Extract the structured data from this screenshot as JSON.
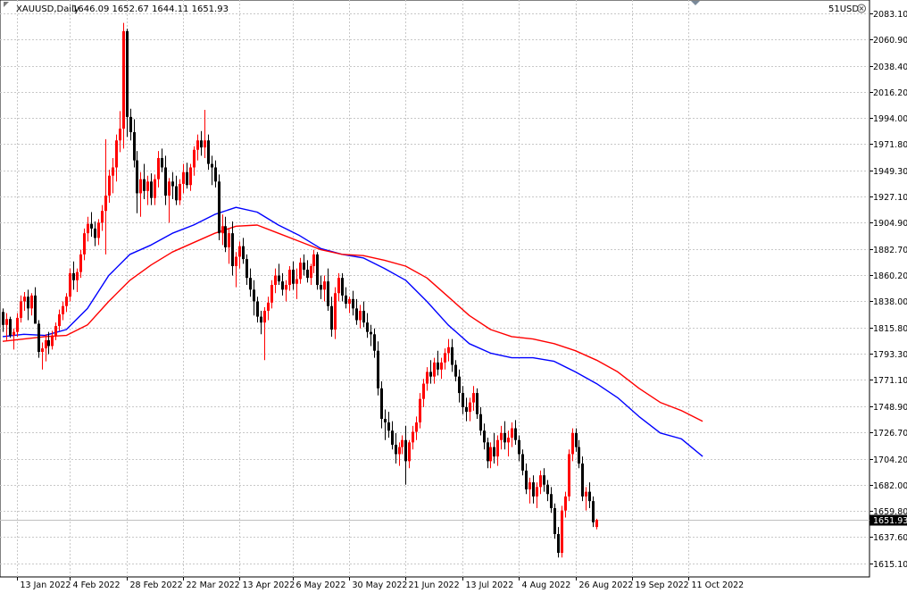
{
  "header": {
    "symbol_timeframe": "XAUUSD,Daily",
    "ohlc": "1646.09 1652.67 1644.11 1651.93",
    "account_label": "51USD"
  },
  "icons": {
    "close": "close-circle-icon",
    "scroll_marker": "triangle-down-icon"
  },
  "colors": {
    "background": "#ffffff",
    "grid": "#c8c8c8",
    "axis": "#000000",
    "bull_candle": "#ff0000",
    "bear_candle": "#000000",
    "ma_fast": "#0000ff",
    "ma_slow": "#ff0000",
    "last_price_tag_bg": "#000000",
    "last_price_tag_fg": "#ffffff",
    "last_price_line": "#c0c0c0"
  },
  "chart_data": {
    "type": "candlestick",
    "title": "",
    "symbol": "XAUUSD",
    "timeframe": "Daily",
    "ylim": [
      1603.5,
      2094.5
    ],
    "grid": true,
    "last_price": 1651.93,
    "last_price_label": "1651.93",
    "y_ticks": [
      {
        "value": 2083.1,
        "label": "2083.10"
      },
      {
        "value": 2060.9,
        "label": "2060.90"
      },
      {
        "value": 2038.4,
        "label": "2038.40"
      },
      {
        "value": 2016.2,
        "label": "2016.20"
      },
      {
        "value": 1994.0,
        "label": "1994.00"
      },
      {
        "value": 1971.8,
        "label": "1971.80"
      },
      {
        "value": 1949.3,
        "label": "1949.30"
      },
      {
        "value": 1927.1,
        "label": "1927.10"
      },
      {
        "value": 1904.9,
        "label": "1904.90"
      },
      {
        "value": 1882.7,
        "label": "1882.70"
      },
      {
        "value": 1860.2,
        "label": "1860.20"
      },
      {
        "value": 1838.0,
        "label": "1838.00"
      },
      {
        "value": 1815.8,
        "label": "1815.80"
      },
      {
        "value": 1793.3,
        "label": "1793.30"
      },
      {
        "value": 1771.1,
        "label": "1771.10"
      },
      {
        "value": 1748.9,
        "label": "1748.90"
      },
      {
        "value": 1726.7,
        "label": "1726.70"
      },
      {
        "value": 1704.2,
        "label": "1704.20"
      },
      {
        "value": 1682.0,
        "label": "1682.00"
      },
      {
        "value": 1659.8,
        "label": "1659.80"
      },
      {
        "value": 1637.6,
        "label": "1637.60"
      },
      {
        "value": 1615.1,
        "label": "1615.10"
      }
    ],
    "x_ticks": [
      {
        "index": 4,
        "label": "13 Jan 2022"
      },
      {
        "index": 19,
        "label": "4 Feb 2022"
      },
      {
        "index": 35,
        "label": "28 Feb 2022"
      },
      {
        "index": 51,
        "label": "22 Mar 2022"
      },
      {
        "index": 67,
        "label": "13 Apr 2022"
      },
      {
        "index": 82,
        "label": "6 May 2022"
      },
      {
        "index": 98,
        "label": "30 May 2022"
      },
      {
        "index": 114,
        "label": "21 Jun 2022"
      },
      {
        "index": 130,
        "label": "13 Jul 2022"
      },
      {
        "index": 146,
        "label": "4 Aug 2022"
      },
      {
        "index": 162,
        "label": "26 Aug 2022"
      },
      {
        "index": 178,
        "label": "19 Sep 2022"
      },
      {
        "index": 194,
        "label": "11 Oct 2022"
      }
    ],
    "candles": [
      [
        1829,
        1832,
        1812,
        1818
      ],
      [
        1818,
        1828,
        1805,
        1823
      ],
      [
        1823,
        1825,
        1807,
        1809
      ],
      [
        1809,
        1815,
        1797,
        1812
      ],
      [
        1812,
        1828,
        1808,
        1824
      ],
      [
        1824,
        1843,
        1820,
        1838
      ],
      [
        1838,
        1846,
        1830,
        1842
      ],
      [
        1842,
        1848,
        1822,
        1832
      ],
      [
        1832,
        1845,
        1826,
        1843
      ],
      [
        1843,
        1850,
        1832,
        1819
      ],
      [
        1819,
        1822,
        1790,
        1795
      ],
      [
        1795,
        1803,
        1780,
        1798
      ],
      [
        1798,
        1810,
        1787,
        1805
      ],
      [
        1805,
        1812,
        1793,
        1800
      ],
      [
        1800,
        1813,
        1797,
        1809
      ],
      [
        1809,
        1820,
        1805,
        1817
      ],
      [
        1817,
        1831,
        1813,
        1827
      ],
      [
        1827,
        1838,
        1822,
        1834
      ],
      [
        1834,
        1845,
        1829,
        1842
      ],
      [
        1842,
        1866,
        1838,
        1862
      ],
      [
        1862,
        1872,
        1848,
        1856
      ],
      [
        1856,
        1866,
        1846,
        1863
      ],
      [
        1863,
        1882,
        1858,
        1878
      ],
      [
        1878,
        1900,
        1873,
        1896
      ],
      [
        1896,
        1910,
        1889,
        1904
      ],
      [
        1904,
        1914,
        1893,
        1900
      ],
      [
        1900,
        1906,
        1885,
        1892
      ],
      [
        1892,
        1908,
        1886,
        1905
      ],
      [
        1905,
        1920,
        1898,
        1915
      ],
      [
        1915,
        1976,
        1878,
        1928
      ],
      [
        1928,
        1950,
        1922,
        1945
      ],
      [
        1945,
        1960,
        1930,
        1952
      ],
      [
        1952,
        1980,
        1940,
        1975
      ],
      [
        1975,
        2000,
        1965,
        1985
      ],
      [
        1985,
        2075,
        1968,
        2068
      ],
      [
        2068,
        2070,
        1978,
        1995
      ],
      [
        1995,
        2002,
        1975,
        1982
      ],
      [
        1982,
        1993,
        1952,
        1958
      ],
      [
        1958,
        1966,
        1913,
        1930
      ],
      [
        1930,
        1948,
        1910,
        1942
      ],
      [
        1942,
        1955,
        1925,
        1932
      ],
      [
        1932,
        1945,
        1920,
        1940
      ],
      [
        1940,
        1947,
        1920,
        1926
      ],
      [
        1926,
        1946,
        1920,
        1942
      ],
      [
        1942,
        1966,
        1935,
        1960
      ],
      [
        1960,
        1968,
        1948,
        1952
      ],
      [
        1952,
        1962,
        1920,
        1928
      ],
      [
        1928,
        1943,
        1905,
        1940
      ],
      [
        1940,
        1948,
        1925,
        1936
      ],
      [
        1936,
        1945,
        1920,
        1924
      ],
      [
        1924,
        1942,
        1920,
        1938
      ],
      [
        1938,
        1955,
        1930,
        1948
      ],
      [
        1948,
        1956,
        1934,
        1937
      ],
      [
        1937,
        1955,
        1932,
        1952
      ],
      [
        1952,
        1970,
        1945,
        1967
      ],
      [
        1967,
        1980,
        1958,
        1975
      ],
      [
        1975,
        1983,
        1962,
        1969
      ],
      [
        1969,
        2001,
        1960,
        1975
      ],
      [
        1975,
        1980,
        1950,
        1955
      ],
      [
        1955,
        1962,
        1937,
        1952
      ],
      [
        1952,
        1958,
        1935,
        1940
      ],
      [
        1940,
        1946,
        1890,
        1896
      ],
      [
        1896,
        1912,
        1886,
        1902
      ],
      [
        1902,
        1910,
        1880,
        1884
      ],
      [
        1884,
        1900,
        1870,
        1896
      ],
      [
        1896,
        1906,
        1860,
        1868
      ],
      [
        1868,
        1880,
        1850,
        1876
      ],
      [
        1876,
        1889,
        1866,
        1885
      ],
      [
        1885,
        1892,
        1870,
        1874
      ],
      [
        1874,
        1878,
        1852,
        1858
      ],
      [
        1858,
        1866,
        1842,
        1848
      ],
      [
        1848,
        1856,
        1826,
        1838
      ],
      [
        1838,
        1842,
        1820,
        1825
      ],
      [
        1825,
        1830,
        1810,
        1820
      ],
      [
        1820,
        1833,
        1788,
        1830
      ],
      [
        1830,
        1842,
        1822,
        1837
      ],
      [
        1837,
        1856,
        1832,
        1852
      ],
      [
        1852,
        1866,
        1845,
        1860
      ],
      [
        1860,
        1870,
        1852,
        1855
      ],
      [
        1855,
        1862,
        1843,
        1848
      ],
      [
        1848,
        1856,
        1838,
        1852
      ],
      [
        1852,
        1868,
        1847,
        1865
      ],
      [
        1865,
        1872,
        1848,
        1853
      ],
      [
        1853,
        1866,
        1840,
        1857
      ],
      [
        1857,
        1875,
        1853,
        1871
      ],
      [
        1871,
        1878,
        1860,
        1865
      ],
      [
        1865,
        1873,
        1854,
        1858
      ],
      [
        1858,
        1870,
        1852,
        1868
      ],
      [
        1868,
        1882,
        1862,
        1878
      ],
      [
        1878,
        1880,
        1848,
        1852
      ],
      [
        1852,
        1860,
        1840,
        1848
      ],
      [
        1848,
        1860,
        1838,
        1855
      ],
      [
        1855,
        1866,
        1830,
        1834
      ],
      [
        1834,
        1842,
        1808,
        1814
      ],
      [
        1814,
        1850,
        1806,
        1845
      ],
      [
        1845,
        1862,
        1838,
        1858
      ],
      [
        1858,
        1862,
        1838,
        1843
      ],
      [
        1843,
        1850,
        1832,
        1836
      ],
      [
        1836,
        1842,
        1828,
        1840
      ],
      [
        1840,
        1847,
        1826,
        1832
      ],
      [
        1832,
        1840,
        1818,
        1822
      ],
      [
        1822,
        1835,
        1815,
        1830
      ],
      [
        1830,
        1838,
        1816,
        1820
      ],
      [
        1820,
        1828,
        1807,
        1812
      ],
      [
        1812,
        1818,
        1800,
        1810
      ],
      [
        1810,
        1815,
        1790,
        1796
      ],
      [
        1796,
        1804,
        1758,
        1764
      ],
      [
        1764,
        1770,
        1730,
        1738
      ],
      [
        1738,
        1746,
        1720,
        1735
      ],
      [
        1735,
        1744,
        1722,
        1728
      ],
      [
        1728,
        1736,
        1712,
        1716
      ],
      [
        1716,
        1726,
        1700,
        1708
      ],
      [
        1708,
        1718,
        1698,
        1714
      ],
      [
        1714,
        1724,
        1708,
        1720
      ],
      [
        1720,
        1732,
        1682,
        1702
      ],
      [
        1702,
        1720,
        1696,
        1718
      ],
      [
        1718,
        1732,
        1712,
        1727
      ],
      [
        1727,
        1740,
        1720,
        1735
      ],
      [
        1735,
        1760,
        1730,
        1755
      ],
      [
        1755,
        1772,
        1748,
        1768
      ],
      [
        1768,
        1782,
        1762,
        1778
      ],
      [
        1778,
        1788,
        1768,
        1774
      ],
      [
        1774,
        1790,
        1768,
        1786
      ],
      [
        1786,
        1796,
        1775,
        1780
      ],
      [
        1780,
        1790,
        1772,
        1786
      ],
      [
        1786,
        1798,
        1780,
        1794
      ],
      [
        1794,
        1806,
        1787,
        1799
      ],
      [
        1799,
        1806,
        1778,
        1784
      ],
      [
        1784,
        1788,
        1770,
        1774
      ],
      [
        1774,
        1780,
        1752,
        1760
      ],
      [
        1760,
        1766,
        1742,
        1748
      ],
      [
        1748,
        1756,
        1736,
        1744
      ],
      [
        1744,
        1756,
        1736,
        1752
      ],
      [
        1752,
        1766,
        1745,
        1760
      ],
      [
        1760,
        1764,
        1738,
        1742
      ],
      [
        1742,
        1748,
        1724,
        1728
      ],
      [
        1728,
        1734,
        1712,
        1718
      ],
      [
        1718,
        1722,
        1696,
        1702
      ],
      [
        1702,
        1718,
        1696,
        1714
      ],
      [
        1714,
        1726,
        1700,
        1706
      ],
      [
        1706,
        1724,
        1698,
        1720
      ],
      [
        1720,
        1732,
        1712,
        1726
      ],
      [
        1726,
        1736,
        1712,
        1718
      ],
      [
        1718,
        1728,
        1706,
        1722
      ],
      [
        1722,
        1735,
        1714,
        1730
      ],
      [
        1730,
        1737,
        1716,
        1720
      ],
      [
        1720,
        1724,
        1702,
        1708
      ],
      [
        1708,
        1712,
        1690,
        1694
      ],
      [
        1694,
        1700,
        1674,
        1678
      ],
      [
        1678,
        1688,
        1666,
        1684
      ],
      [
        1684,
        1690,
        1666,
        1672
      ],
      [
        1672,
        1684,
        1662,
        1680
      ],
      [
        1680,
        1694,
        1674,
        1690
      ],
      [
        1690,
        1696,
        1676,
        1682
      ],
      [
        1682,
        1686,
        1668,
        1674
      ],
      [
        1674,
        1680,
        1658,
        1662
      ],
      [
        1662,
        1666,
        1636,
        1640
      ],
      [
        1640,
        1646,
        1620,
        1624
      ],
      [
        1624,
        1664,
        1620,
        1660
      ],
      [
        1660,
        1676,
        1654,
        1672
      ],
      [
        1672,
        1712,
        1668,
        1708
      ],
      [
        1708,
        1730,
        1702,
        1726
      ],
      [
        1726,
        1730,
        1710,
        1714
      ],
      [
        1714,
        1720,
        1696,
        1700
      ],
      [
        1700,
        1706,
        1668,
        1672
      ],
      [
        1672,
        1680,
        1660,
        1676
      ],
      [
        1676,
        1684,
        1662,
        1668
      ],
      [
        1668,
        1672,
        1646,
        1650
      ],
      [
        1646,
        1653,
        1644,
        1652
      ]
    ],
    "series": [
      {
        "type": "line",
        "points": [
          [
            0,
            1808
          ],
          [
            6,
            1810
          ],
          [
            12,
            1809
          ],
          [
            18,
            1814
          ],
          [
            24,
            1832
          ],
          [
            30,
            1860
          ],
          [
            36,
            1878
          ],
          [
            42,
            1886
          ],
          [
            48,
            1896
          ],
          [
            54,
            1903
          ],
          [
            60,
            1912
          ],
          [
            66,
            1918
          ],
          [
            72,
            1914
          ],
          [
            78,
            1903
          ],
          [
            84,
            1894
          ],
          [
            90,
            1883
          ],
          [
            96,
            1878
          ],
          [
            102,
            1875
          ],
          [
            108,
            1866
          ],
          [
            114,
            1856
          ],
          [
            120,
            1838
          ],
          [
            126,
            1818
          ],
          [
            132,
            1802
          ],
          [
            138,
            1794
          ],
          [
            144,
            1790
          ],
          [
            150,
            1790
          ],
          [
            156,
            1787
          ],
          [
            162,
            1778
          ],
          [
            168,
            1768
          ],
          [
            174,
            1756
          ],
          [
            180,
            1740
          ],
          [
            186,
            1726
          ],
          [
            192,
            1721
          ],
          [
            198,
            1706
          ]
        ]
      },
      {
        "type": "line",
        "points": [
          [
            0,
            1804
          ],
          [
            6,
            1806
          ],
          [
            12,
            1808
          ],
          [
            18,
            1809
          ],
          [
            24,
            1818
          ],
          [
            30,
            1838
          ],
          [
            36,
            1856
          ],
          [
            42,
            1869
          ],
          [
            48,
            1880
          ],
          [
            54,
            1888
          ],
          [
            60,
            1896
          ],
          [
            66,
            1902
          ],
          [
            72,
            1903
          ],
          [
            78,
            1896
          ],
          [
            84,
            1889
          ],
          [
            90,
            1882
          ],
          [
            96,
            1878
          ],
          [
            102,
            1877
          ],
          [
            108,
            1873
          ],
          [
            114,
            1868
          ],
          [
            120,
            1858
          ],
          [
            126,
            1842
          ],
          [
            132,
            1826
          ],
          [
            138,
            1814
          ],
          [
            144,
            1808
          ],
          [
            150,
            1806
          ],
          [
            156,
            1802
          ],
          [
            162,
            1796
          ],
          [
            168,
            1788
          ],
          [
            174,
            1778
          ],
          [
            180,
            1764
          ],
          [
            186,
            1752
          ],
          [
            192,
            1745
          ],
          [
            198,
            1736
          ]
        ]
      }
    ]
  }
}
